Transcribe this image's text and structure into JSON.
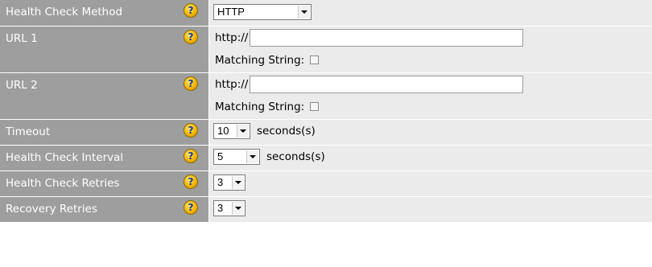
{
  "rows": [
    {
      "label": "Health Check Method",
      "help_icon": "?",
      "select_value": "HTTP"
    },
    {
      "label": "URL 1",
      "help_icon": "?",
      "url_prefix": "http://",
      "url_value": "",
      "matching_label": "Matching String:",
      "matching_checked": false
    },
    {
      "label": "URL 2",
      "help_icon": "?",
      "url_prefix": "http://",
      "url_value": "",
      "matching_label": "Matching String:",
      "matching_checked": false
    },
    {
      "label": "Timeout",
      "help_icon": "?",
      "select_value": "10",
      "unit": "seconds(s)"
    },
    {
      "label": "Health Check Interval",
      "help_icon": "?",
      "select_value": "5",
      "unit": "seconds(s)"
    },
    {
      "label": "Health Check Retries",
      "help_icon": "?",
      "select_value": "3"
    },
    {
      "label": "Recovery Retries",
      "help_icon": "?",
      "select_value": "3"
    }
  ],
  "colors": {
    "label_bg": "#9e9e9e",
    "value_bg": "#ebebeb",
    "help_icon": "#f1b400"
  }
}
